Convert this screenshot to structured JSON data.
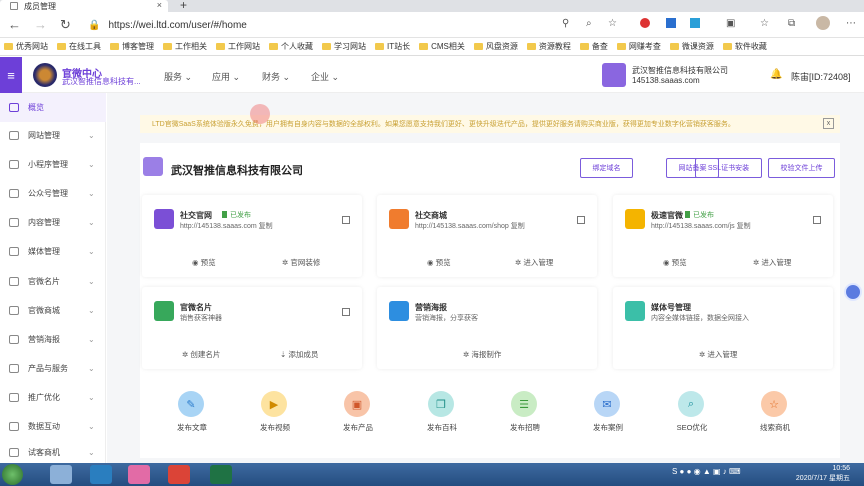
{
  "browser": {
    "tab_title": "成员管理",
    "url": "https://wei.ltd.com/user/#/home",
    "bookmarks": [
      "优秀网站",
      "在线工具",
      "博客管理",
      "工作相关",
      "工作网站",
      "个人收藏",
      "学习网站",
      "IT站长",
      "CMS相关",
      "风盘资源",
      "资源教程",
      "备查",
      "网赚考查",
      "微课资源",
      "软件收藏"
    ]
  },
  "header": {
    "brand_title": "官微中心",
    "brand_sub": "武汉智推信息科技有...",
    "menus": [
      "服务",
      "应用",
      "财务",
      "企业"
    ],
    "company_name": "武汉智推信息科技有限公司",
    "company_domain": "145138.saaas.com",
    "user": "陈宙[ID:72408]"
  },
  "sidebar": {
    "items": [
      {
        "label": "概览"
      },
      {
        "label": "网站管理"
      },
      {
        "label": "小程序管理"
      },
      {
        "label": "公众号管理"
      },
      {
        "label": "内容管理"
      },
      {
        "label": "媒体管理"
      },
      {
        "label": "官微名片"
      },
      {
        "label": "官微商城"
      },
      {
        "label": "营销海报"
      },
      {
        "label": "产品与服务"
      },
      {
        "label": "推广优化"
      },
      {
        "label": "数据互动"
      },
      {
        "label": "试客商机"
      }
    ]
  },
  "notice": {
    "text": "LTD官微SaaS系统体验版永久免费，用户拥有自身内容与数据的全部权利。如果您愿意支持我们更好、更快升级迭代产品，提供更好服务请购买商业版，获得更加专业数字化营销获客服务。",
    "close": "x"
  },
  "company": {
    "title": "武汉智推信息科技有限公司",
    "buttons": [
      "绑定域名",
      "网站备案",
      "SSL证书安装",
      "校验文件上传"
    ]
  },
  "cards": [
    {
      "title": "社交官网",
      "status": "已发布",
      "url": "http://145138.saaas.com 复制",
      "actions": [
        "预览",
        "官网装修"
      ]
    },
    {
      "title": "社交商城",
      "status": "",
      "url": "http://145138.saaas.com/shop 复制",
      "actions": [
        "预览",
        "进入管理"
      ]
    },
    {
      "title": "极速官微",
      "status": "已发布",
      "url": "http://145138.saaas.com/js 复制",
      "actions": [
        "预览",
        "进入管理"
      ]
    },
    {
      "title": "官微名片",
      "status": "",
      "url": "销售获客神器",
      "actions": [
        "创建名片",
        "添加成员"
      ]
    },
    {
      "title": "营销海报",
      "status": "",
      "url": "营销海报，分享获客",
      "actions": [
        "海报制作"
      ]
    },
    {
      "title": "媒体号管理",
      "status": "",
      "url": "内容全媒体链接，数据全网接入",
      "actions": [
        "进入管理"
      ]
    }
  ],
  "tools": [
    "发布文章",
    "发布视频",
    "发布产品",
    "发布百科",
    "发布招聘",
    "发布案例",
    "SEO优化",
    "线索商机"
  ],
  "taskbar": {
    "time": "10:56",
    "date": "2020/7/17 星期五"
  },
  "colors": {
    "accent": "#6d3fd8",
    "notice_bg": "#fff9e6",
    "publish_green": "#43a047"
  }
}
